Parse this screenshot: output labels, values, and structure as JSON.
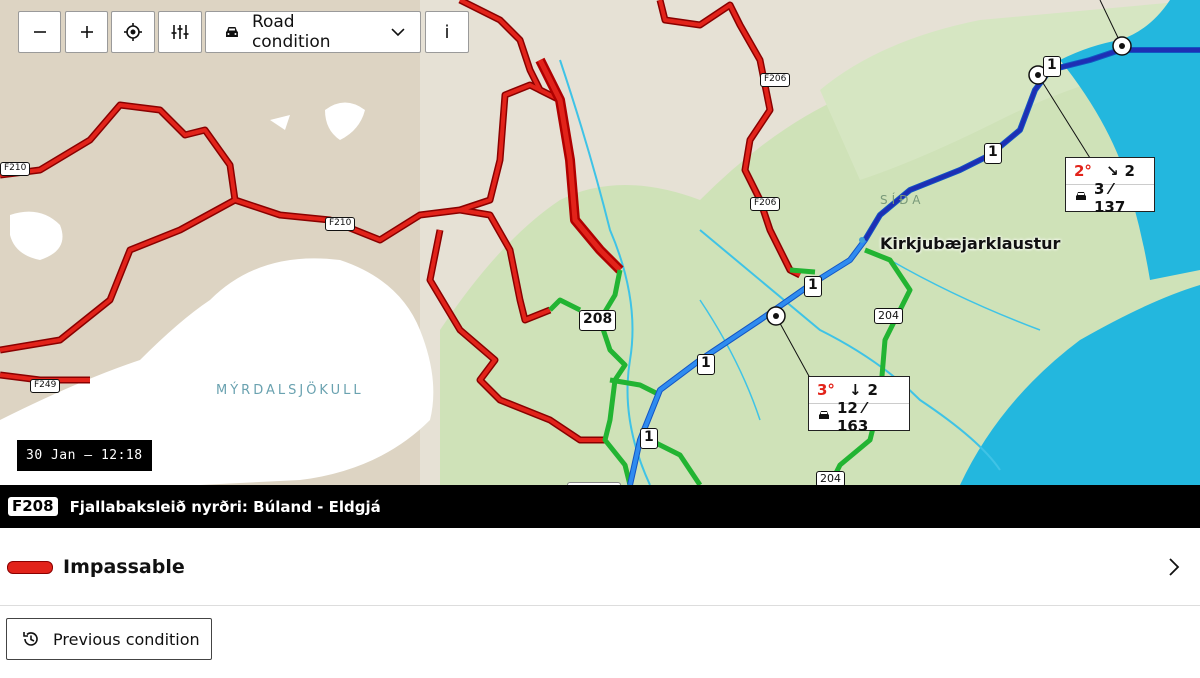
{
  "controls": {
    "zoom_out_icon": "minus-icon",
    "zoom_in_icon": "plus-icon",
    "locate_icon": "crosshair-icon",
    "filter_icon": "sliders-icon",
    "layer_label": "Road condition",
    "layer_icon": "car-icon",
    "info_label": "i"
  },
  "map": {
    "route_shields_small": [
      "F206",
      "F206",
      "F210",
      "F210",
      "F249"
    ],
    "route_shields_big": [
      "208",
      "1",
      "1",
      "1",
      "1",
      "204",
      "204"
    ],
    "place_label": "Kirkjubæjarklaustur",
    "glacier_label": "MÝRDALSJÖKULL",
    "area_label": "SÍÐA",
    "weather_stations": [
      {
        "temp": "2°",
        "wind_dir": "↘",
        "wind": "2",
        "traffic": "3 ⁄ 137"
      },
      {
        "temp": "3°",
        "wind_dir": "↓",
        "wind": "2",
        "traffic": "12 ⁄ 163"
      }
    ],
    "timestamp": "30 Jan — 12:18",
    "colors": {
      "impassable": "#e2231a",
      "easy": "#22b432",
      "route1_blue": "#1e7be6",
      "route1_dark": "#1432b4",
      "water": "#23b7de"
    }
  },
  "selected_road": {
    "number": "F208",
    "name": "Fjallabaksleið nyrðri: Búland - Eldgjá"
  },
  "condition": {
    "label": "Impassable",
    "chevron_icon": "chevron-right-icon"
  },
  "history_button": {
    "label": "Previous condition",
    "icon": "history-icon"
  }
}
